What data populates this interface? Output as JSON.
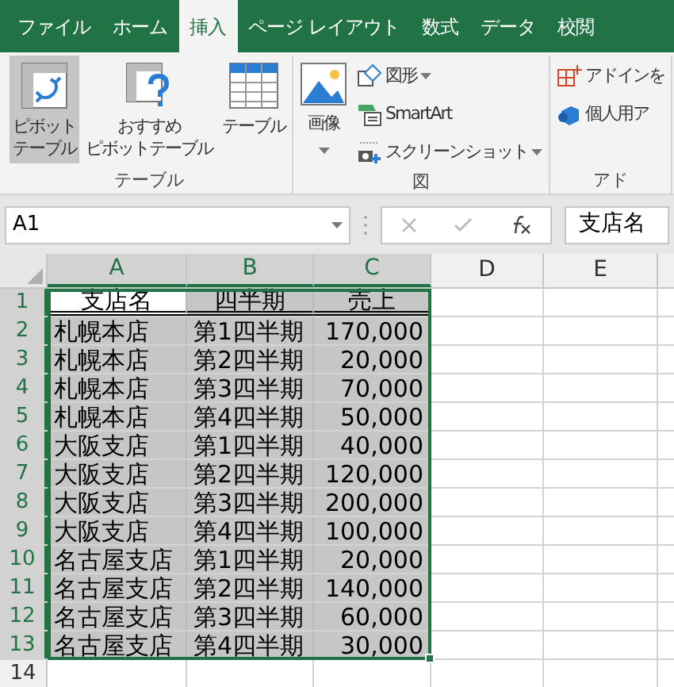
{
  "tabs": [
    {
      "label": "ファイル",
      "selected": false
    },
    {
      "label": "ホーム",
      "selected": false
    },
    {
      "label": "挿入",
      "selected": true
    },
    {
      "label": "ページ レイアウト",
      "selected": false
    },
    {
      "label": "数式",
      "selected": false
    },
    {
      "label": "データ",
      "selected": false
    },
    {
      "label": "校閲",
      "selected": false
    }
  ],
  "ribbon": {
    "groups": [
      {
        "label": "テーブル",
        "items": [
          {
            "kind": "pivot",
            "label": "ピボットテーブル",
            "highlighted": true,
            "dropdown": false
          },
          {
            "kind": "recommended",
            "label": "おすすめピボットテーブル",
            "highlighted": false,
            "dropdown": false
          },
          {
            "kind": "table",
            "label": "テーブル",
            "highlighted": false,
            "dropdown": false
          }
        ]
      },
      {
        "label": "図",
        "items": [
          {
            "kind": "image",
            "label": "画像",
            "highlighted": false,
            "dropdown": true
          },
          {
            "kind": "shapes",
            "label": "図形",
            "highlighted": false,
            "dropdown": true
          },
          {
            "kind": "smartart",
            "label": "SmartArt",
            "highlighted": false,
            "dropdown": false
          },
          {
            "kind": "screenshot",
            "label": "スクリーンショット",
            "highlighted": false,
            "dropdown": true
          }
        ]
      },
      {
        "label": "アド",
        "items": [
          {
            "kind": "addin",
            "label": "アドインを",
            "highlighted": false,
            "dropdown": false
          },
          {
            "kind": "personal",
            "label": "個人用ア",
            "highlighted": false,
            "dropdown": false
          }
        ]
      }
    ]
  },
  "formula_bar": {
    "name_box": "A1",
    "formula": "支店名"
  },
  "columns": [
    {
      "label": "A",
      "selected": true
    },
    {
      "label": "B",
      "selected": true
    },
    {
      "label": "C",
      "selected": true
    },
    {
      "label": "D",
      "selected": false
    },
    {
      "label": "E",
      "selected": false
    }
  ],
  "rows": [
    {
      "number": "1",
      "selected": true,
      "cells": [
        "支店名",
        "四半期",
        "売上"
      ]
    },
    {
      "number": "2",
      "selected": true,
      "cells": [
        "札幌本店",
        "第1四半期",
        "170,000"
      ]
    },
    {
      "number": "3",
      "selected": true,
      "cells": [
        "札幌本店",
        "第2四半期",
        "20,000"
      ]
    },
    {
      "number": "4",
      "selected": true,
      "cells": [
        "札幌本店",
        "第3四半期",
        "70,000"
      ]
    },
    {
      "number": "5",
      "selected": true,
      "cells": [
        "札幌本店",
        "第4四半期",
        "50,000"
      ]
    },
    {
      "number": "6",
      "selected": true,
      "cells": [
        "大阪支店",
        "第1四半期",
        "40,000"
      ]
    },
    {
      "number": "7",
      "selected": true,
      "cells": [
        "大阪支店",
        "第2四半期",
        "120,000"
      ]
    },
    {
      "number": "8",
      "selected": true,
      "cells": [
        "大阪支店",
        "第3四半期",
        "200,000"
      ]
    },
    {
      "number": "9",
      "selected": true,
      "cells": [
        "大阪支店",
        "第4四半期",
        "100,000"
      ]
    },
    {
      "number": "10",
      "selected": true,
      "cells": [
        "名古屋支店",
        "第1四半期",
        "20,000"
      ]
    },
    {
      "number": "11",
      "selected": true,
      "cells": [
        "名古屋支店",
        "第2四半期",
        "140,000"
      ]
    },
    {
      "number": "12",
      "selected": true,
      "cells": [
        "名古屋支店",
        "第3四半期",
        "60,000"
      ]
    },
    {
      "number": "13",
      "selected": true,
      "cells": [
        "名古屋支店",
        "第4四半期",
        "30,000"
      ]
    },
    {
      "number": "14",
      "selected": false,
      "cells": []
    }
  ]
}
